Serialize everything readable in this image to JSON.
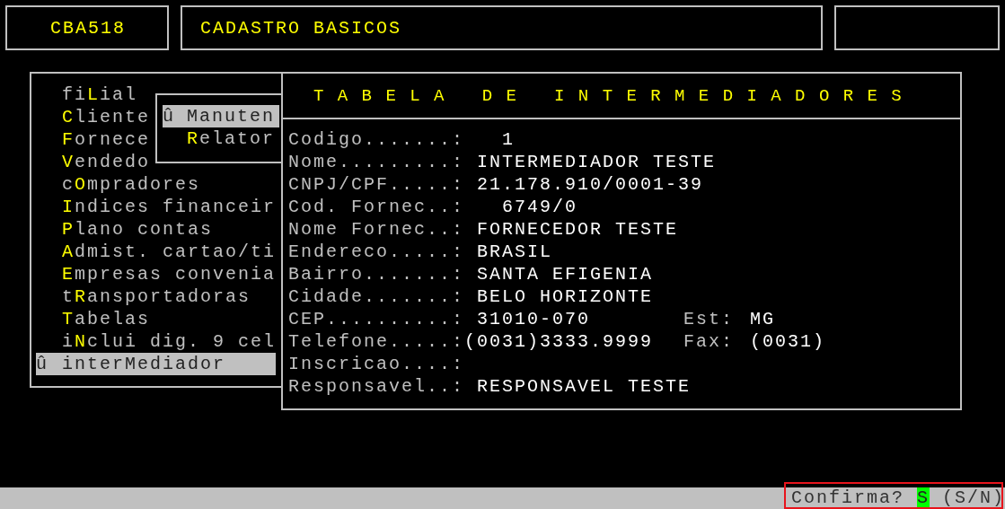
{
  "header": {
    "program_code": "CBA518",
    "module_title": "CADASTRO BASICOS"
  },
  "menu": {
    "items": [
      {
        "pre": "fi",
        "key": "L",
        "post": "ial",
        "selected": false
      },
      {
        "key": "C",
        "post": "liente",
        "selected": false
      },
      {
        "key": "F",
        "post": "ornece",
        "selected": false
      },
      {
        "key": "V",
        "post": "endedo",
        "selected": false
      },
      {
        "pre": "c",
        "key": "O",
        "post": "mpradores",
        "selected": false
      },
      {
        "key": "I",
        "post": "ndices financeir",
        "selected": false
      },
      {
        "key": "P",
        "post": "lano contas",
        "selected": false
      },
      {
        "key": "A",
        "post": "dmist. cartao/ti",
        "selected": false
      },
      {
        "key": "E",
        "post": "mpresas convenia",
        "selected": false
      },
      {
        "pre": "t",
        "key": "R",
        "post": "ansportadoras",
        "selected": false
      },
      {
        "key": "T",
        "post": "abelas",
        "selected": false
      },
      {
        "pre": "i",
        "key": "N",
        "post": "clui dig. 9 cel",
        "selected": false
      },
      {
        "pre": "inter",
        "key": "M",
        "post": "ediador",
        "selected": true,
        "marker": "û"
      }
    ]
  },
  "submenu": {
    "items": [
      {
        "key": "M",
        "post": "anuten",
        "selected": true,
        "marker": "û"
      },
      {
        "key": "R",
        "post": "elator",
        "selected": false
      }
    ]
  },
  "form": {
    "title": "T A B E L A   D E   I N T E R M E D I A D O R E S",
    "fields": [
      {
        "label": "Codigo.......:",
        "value": "1",
        "kind": "code"
      },
      {
        "label": "Nome.........:",
        "value": "INTERMEDIADOR TESTE",
        "kind": "text"
      },
      {
        "label": "CNPJ/CPF.....:",
        "value": "21.178.910/0001-39",
        "kind": "text"
      },
      {
        "label": "Cod. Fornec..:",
        "value": "6749/0",
        "kind": "code"
      },
      {
        "label": "Nome Fornec..:",
        "value": "FORNECEDOR TESTE",
        "kind": "text"
      },
      {
        "label": "Endereco.....:",
        "value": "BRASIL",
        "kind": "text"
      },
      {
        "label": "Bairro.......:",
        "value": "SANTA EFIGENIA",
        "kind": "text"
      },
      {
        "label": "Cidade.......:",
        "value": "BELO HORIZONTE",
        "kind": "text"
      },
      {
        "label": "CEP..........:",
        "value": "31010-070",
        "kind": "text",
        "extra_label": "Est:",
        "extra_value": "MG"
      },
      {
        "label": "Telefone.....:",
        "value": "(0031)3333.9999",
        "kind": "tight",
        "extra_label": "Fax:",
        "extra_value": "(0031)"
      },
      {
        "label": "Inscricao....:"
      },
      {
        "label": "Responsavel..:",
        "value": "RESPONSAVEL TESTE",
        "kind": "text"
      }
    ]
  },
  "status_bar": {
    "question": "Confirma?",
    "answer": "S",
    "options": "(S/N)"
  }
}
